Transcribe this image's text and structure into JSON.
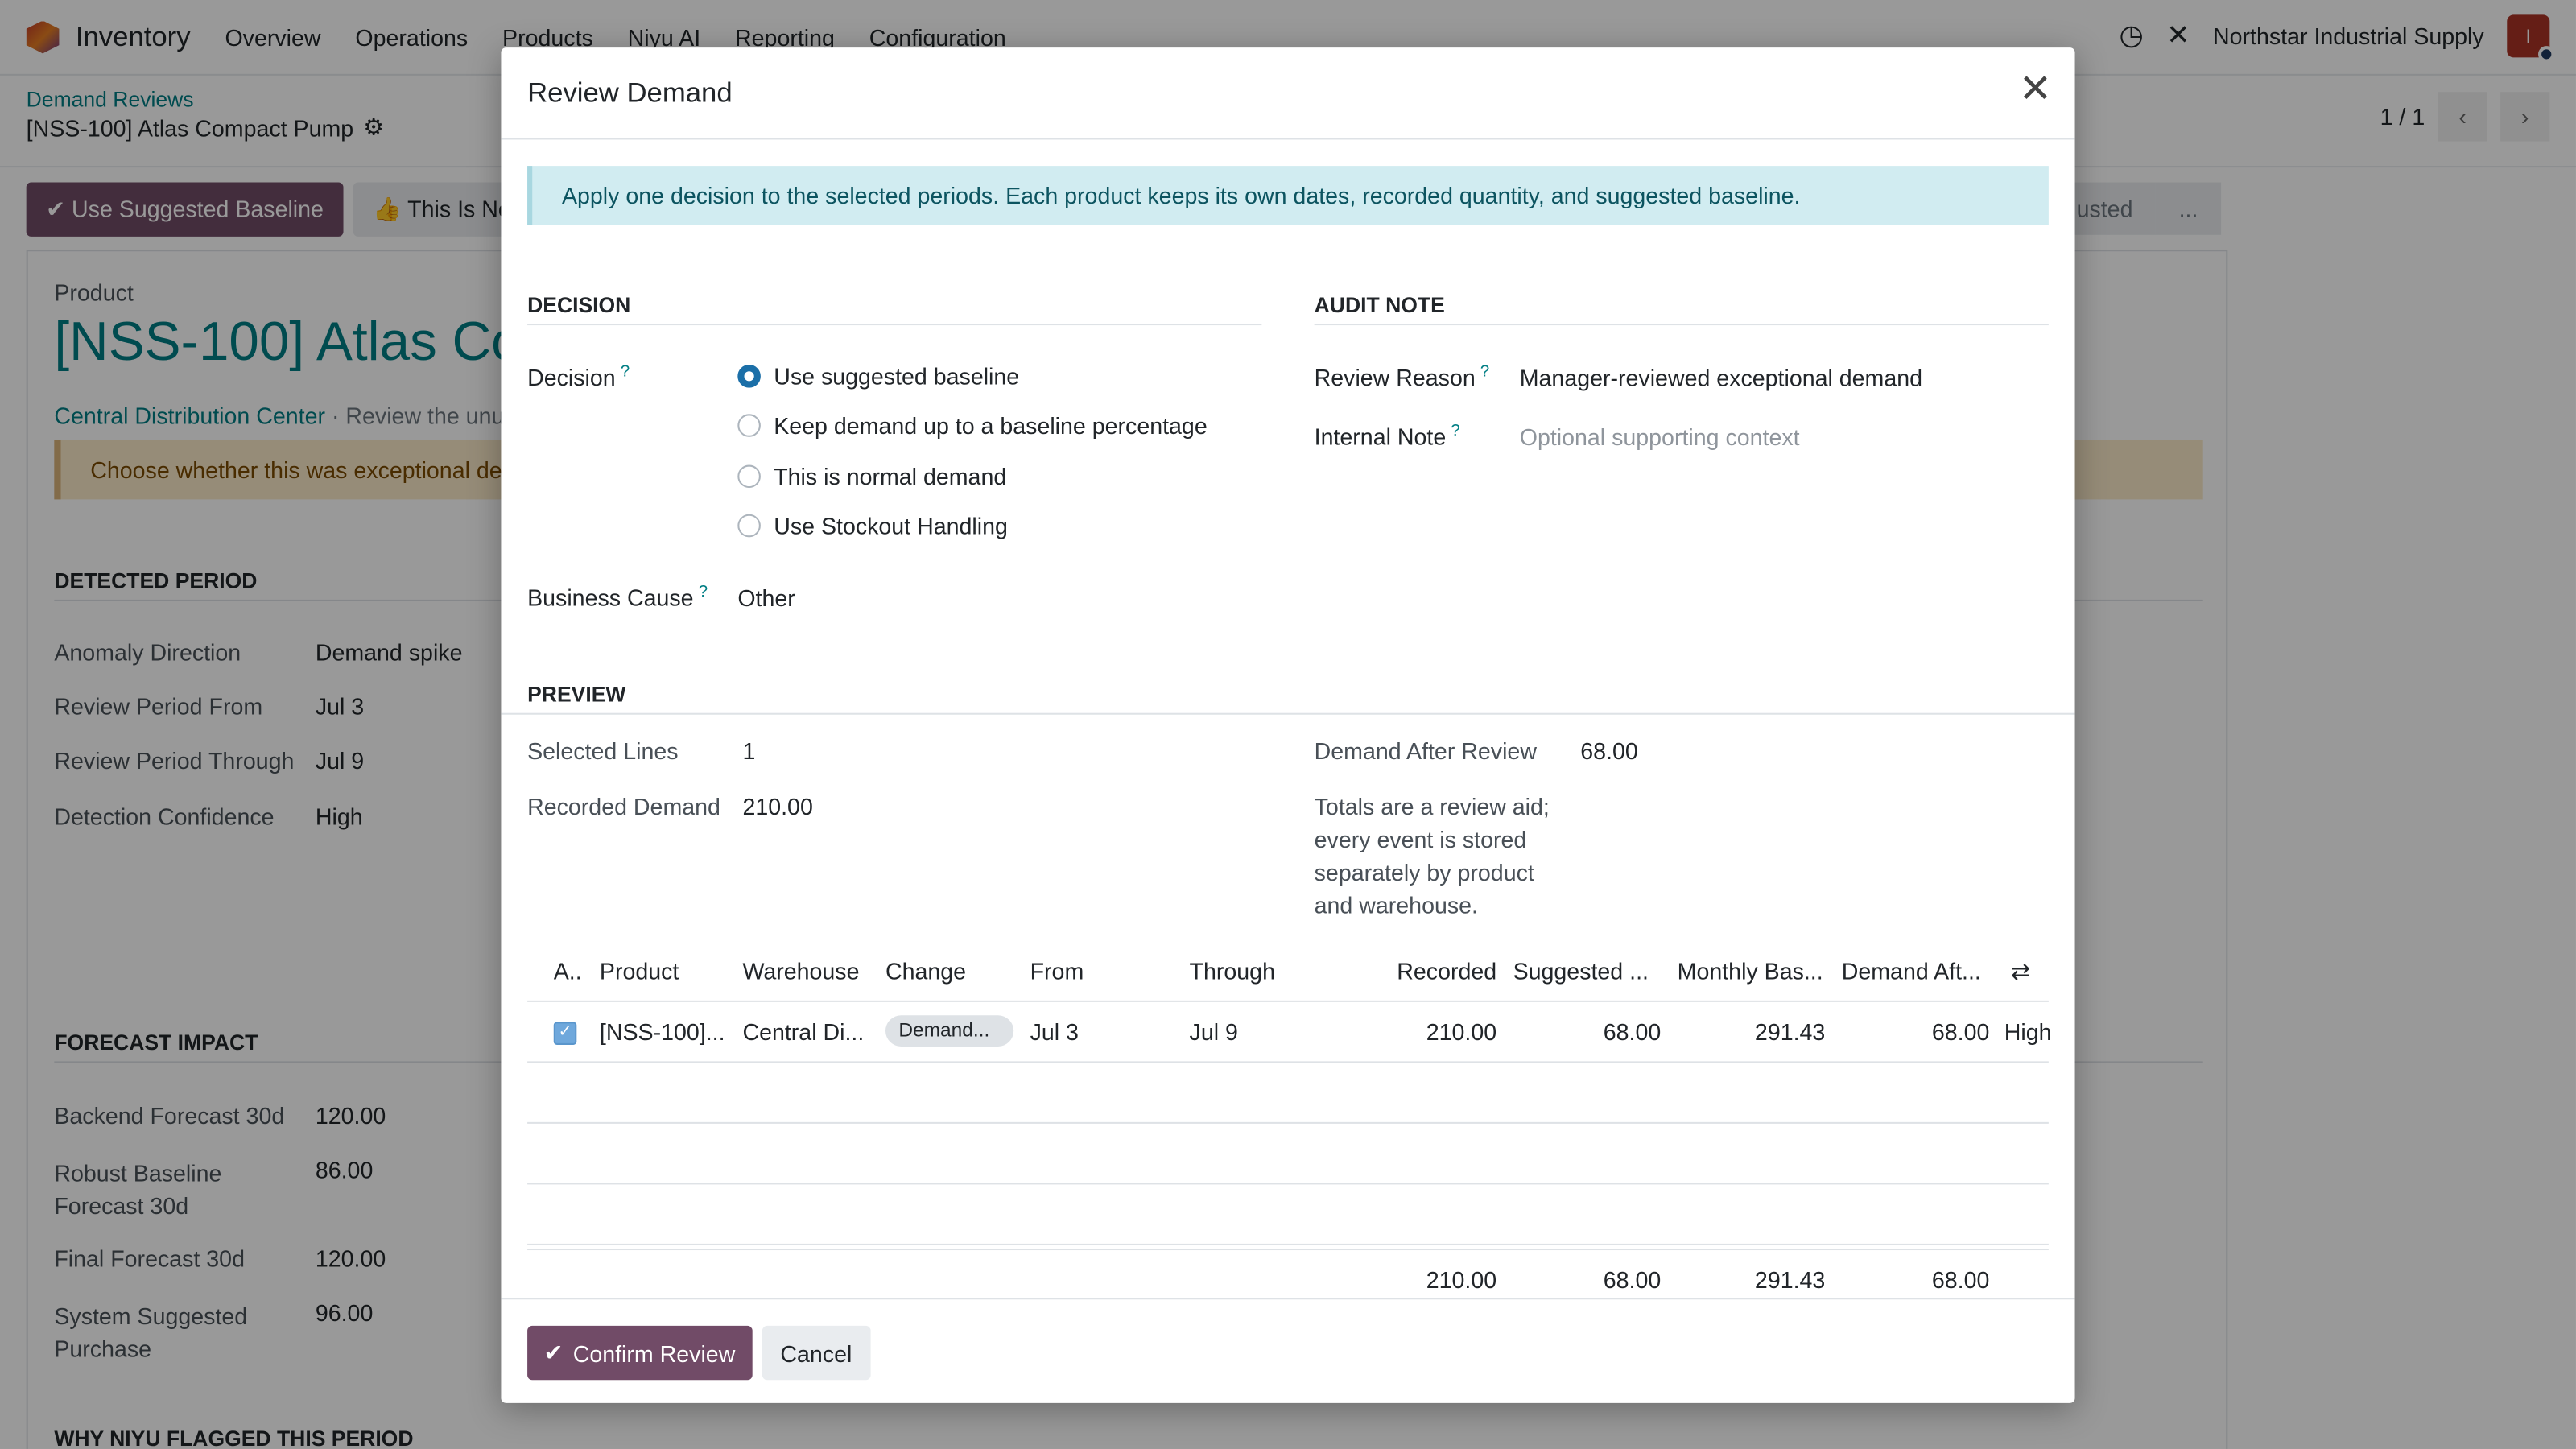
{
  "navbar": {
    "app_name": "Inventory",
    "menu": [
      "Overview",
      "Operations",
      "Products",
      "Niyu AI",
      "Reporting",
      "Configuration"
    ],
    "company": "Northstar Industrial Supply",
    "avatar_initial": "I"
  },
  "control_panel": {
    "breadcrumb": "Demand Reviews",
    "record_title": "[NSS-100] Atlas Compact Pump",
    "pager": "1 / 1",
    "buttons": {
      "use_suggested": "Use Suggested Baseline",
      "this_is_normal": "This Is No"
    },
    "status_steps": [
      "usted",
      "..."
    ]
  },
  "form": {
    "product_label": "Product",
    "product_name": "[NSS-100] Atlas Co",
    "warehouse_link": "Central Distribution Center",
    "subtitle_rest": " · Review the unus",
    "warning": "Choose whether this was exceptional dem",
    "detected_period": {
      "title": "DETECTED PERIOD",
      "rows": [
        {
          "label": "Anomaly Direction",
          "value": "Demand spike"
        },
        {
          "label": "Review Period From",
          "value": "Jul 3"
        },
        {
          "label": "Review Period Through",
          "value": "Jul 9"
        },
        {
          "label": "Detection Confidence",
          "value": "High"
        }
      ]
    },
    "forecast_impact": {
      "title": "FORECAST IMPACT",
      "rows": [
        {
          "label": "Backend Forecast 30d",
          "value": "120.00"
        },
        {
          "label": "Robust Baseline Forecast 30d",
          "value": "86.00"
        },
        {
          "label": "Final Forecast 30d",
          "value": "120.00"
        },
        {
          "label": "System Suggested Purchase",
          "value": "96.00"
        }
      ]
    },
    "why_flagged_title": "WHY NIYU FLAGGED THIS PERIOD"
  },
  "modal": {
    "title": "Review Demand",
    "info": "Apply one decision to the selected periods. Each product keeps its own dates, recorded quantity, and suggested baseline.",
    "decision_section": "DECISION",
    "audit_section": "AUDIT NOTE",
    "decision_label": "Decision",
    "decision_options": [
      {
        "label": "Use suggested baseline",
        "checked": true
      },
      {
        "label": "Keep demand up to a baseline percentage",
        "checked": false
      },
      {
        "label": "This is normal demand",
        "checked": false
      },
      {
        "label": "Use Stockout Handling",
        "checked": false
      }
    ],
    "business_cause_label": "Business Cause",
    "business_cause_value": "Other",
    "review_reason_label": "Review Reason",
    "review_reason_value": "Manager-reviewed exceptional demand",
    "internal_note_label": "Internal Note",
    "internal_note_placeholder": "Optional supporting context",
    "help_mark": "?",
    "preview": {
      "title": "PREVIEW",
      "selected_lines_label": "Selected Lines",
      "selected_lines_value": "1",
      "recorded_demand_label": "Recorded Demand",
      "recorded_demand_value": "210.00",
      "demand_after_label": "Demand After Review",
      "demand_after_value": "68.00",
      "note": "Totals are a review aid; every event is stored separately by product and warehouse."
    },
    "table": {
      "headers": [
        "A..",
        "Product",
        "Warehouse",
        "Change",
        "From",
        "Through",
        "Recorded",
        "Suggested ...",
        "Monthly Bas...",
        "Demand Aft..."
      ],
      "rows": [
        {
          "product": "[NSS-100]...",
          "warehouse": "Central Di...",
          "change": "Demand...",
          "from": "Jul 3",
          "through": "Jul 9",
          "recorded": "210.00",
          "suggested": "68.00",
          "monthly": "291.43",
          "demand_after": "68.00",
          "confidence": "High"
        }
      ],
      "totals": {
        "recorded": "210.00",
        "suggested": "68.00",
        "monthly": "291.43",
        "demand_after": "68.00"
      }
    },
    "confirm_label": "Confirm Review",
    "cancel_label": "Cancel"
  },
  "colors": {
    "primary": "#714b67",
    "link": "#017e84",
    "info_bg": "#d1ecf1",
    "warning_bg": "#fbe9c8",
    "radio_checked": "#1b6fa8"
  }
}
